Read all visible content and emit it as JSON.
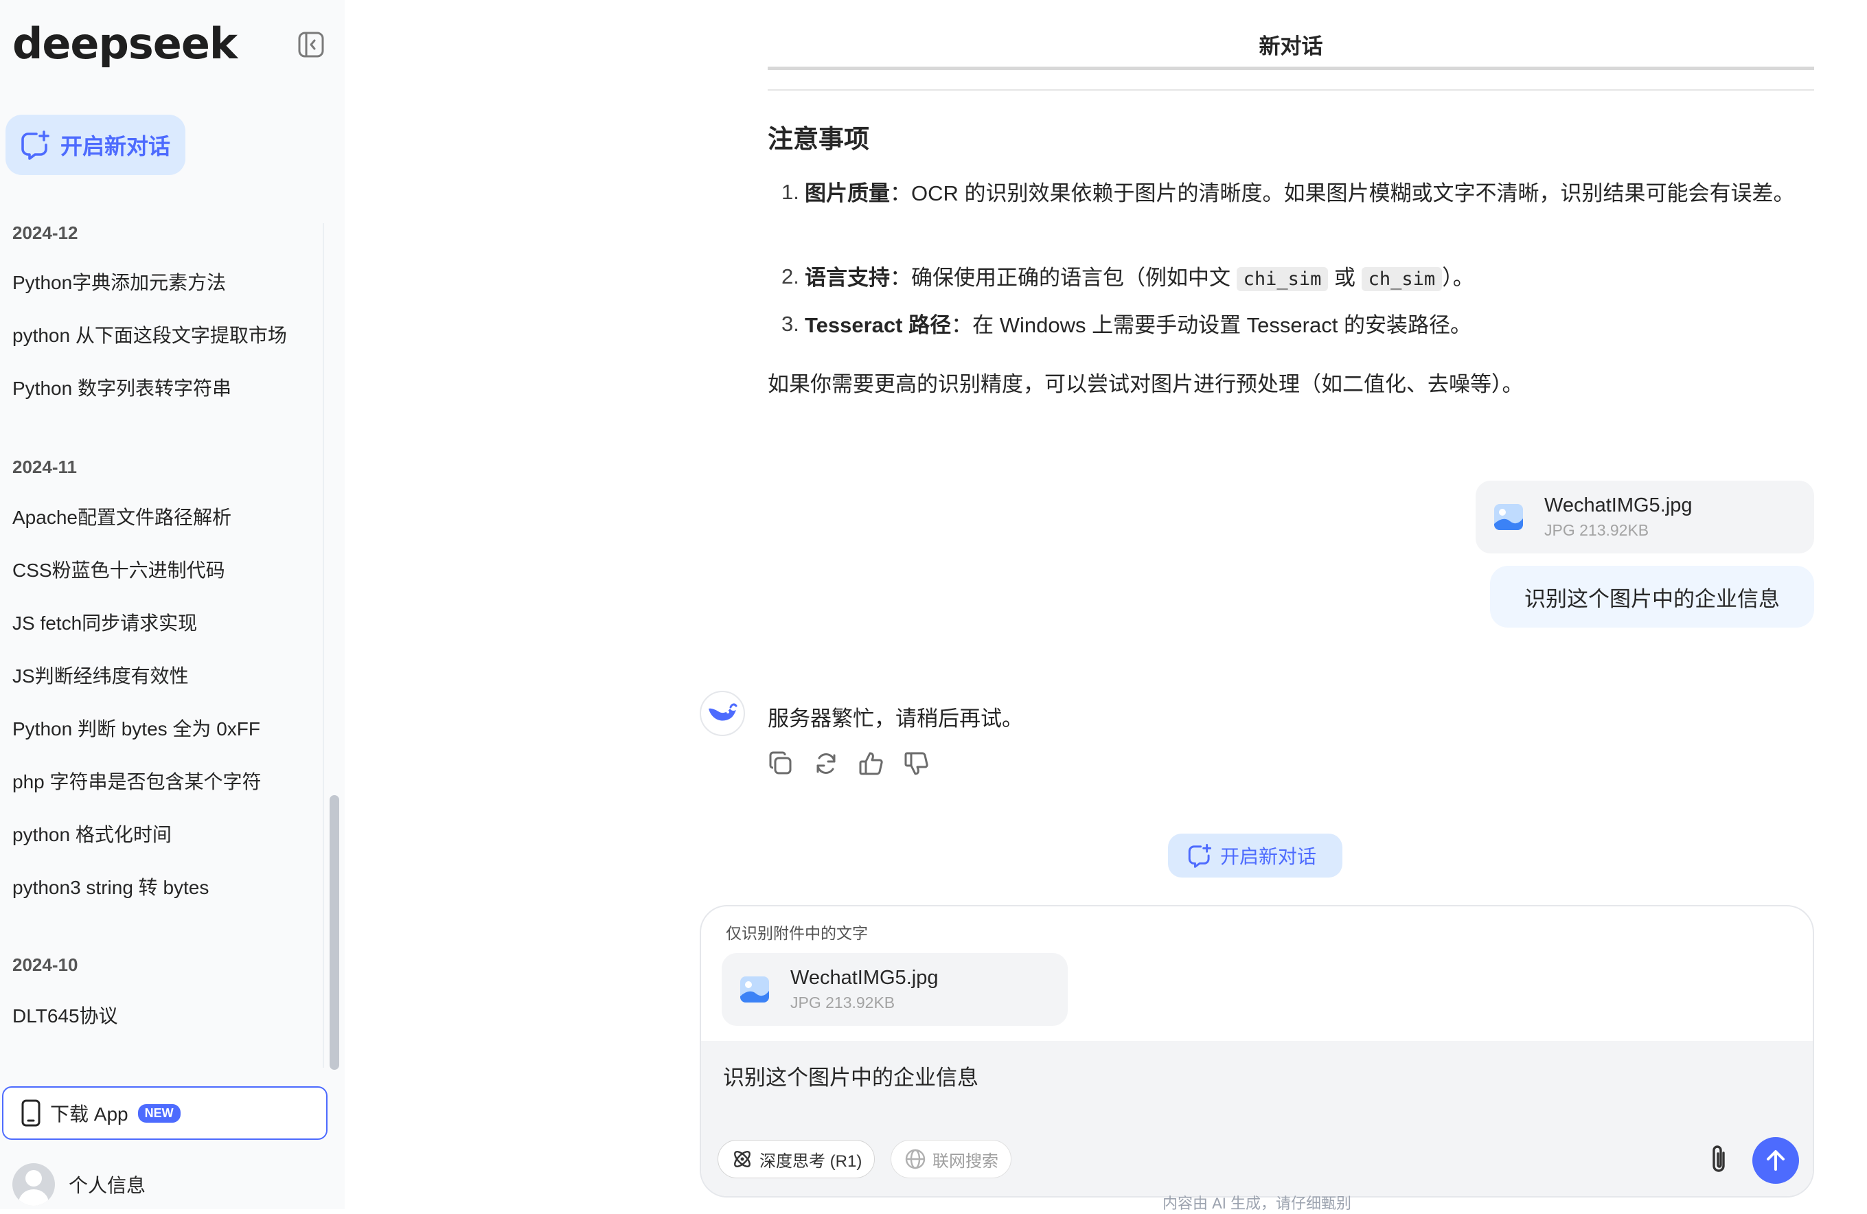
{
  "sidebar": {
    "logo": "deepseek",
    "new_chat": "开启新对话",
    "groups": [
      {
        "title": "2024-12",
        "items": [
          "Python字典添加元素方法",
          "python 从下面这段文字提取市场",
          "Python 数字列表转字符串"
        ]
      },
      {
        "title": "2024-11",
        "items": [
          "Apache配置文件路径解析",
          "CSS粉蓝色十六进制代码",
          "JS fetch同步请求实现",
          "JS判断经纬度有效性",
          "Python 判断 bytes 全为 0xFF",
          "php 字符串是否包含某个字符",
          "python 格式化时间",
          "python3 string 转 bytes"
        ]
      },
      {
        "title": "2024-10",
        "items": [
          "DLT645协议"
        ]
      }
    ],
    "download_app": "下载 App",
    "new_badge": "NEW",
    "profile": "个人信息"
  },
  "header": {
    "title": "新对话"
  },
  "answer": {
    "heading": "注意事项",
    "items": [
      {
        "num": "1.",
        "label": "图片质量",
        "text": "：OCR 的识别效果依赖于图片的清晰度。如果图片模糊或文字不清晰，识别结果可能会有误差。"
      },
      {
        "num": "2.",
        "label": "语言支持",
        "text_a": "：确保使用正确的语言包（例如中文 ",
        "code_a": "chi_sim",
        "text_b": " 或 ",
        "code_b": "ch_sim",
        "text_c": "）。"
      },
      {
        "num": "3.",
        "label": "Tesseract 路径",
        "text": "：在 Windows 上需要手动设置 Tesseract 的安装路径。"
      }
    ],
    "closing": "如果你需要更高的识别精度，可以尝试对图片进行预处理（如二值化、去噪等）。"
  },
  "user_message": {
    "file_name": "WechatIMG5.jpg",
    "file_size": "JPG 213.92KB",
    "text": "识别这个图片中的企业信息"
  },
  "bot_reply": {
    "text": "服务器繁忙，请稍后再试。"
  },
  "mid_new_chat": "开启新对话",
  "composer": {
    "attachment_label": "仅识别附件中的文字",
    "file_name": "WechatIMG5.jpg",
    "file_size": "JPG 213.92KB",
    "input_value": "识别这个图片中的企业信息",
    "deep_think": "深度思考 (R1)",
    "web_search": "联网搜索",
    "disclaimer": "内容由 AI 生成，请仔细甄别"
  },
  "colors": {
    "accent": "#4d6bfe",
    "accent_light": "#dbeafe",
    "sidebar_bg": "#f9fafb"
  }
}
